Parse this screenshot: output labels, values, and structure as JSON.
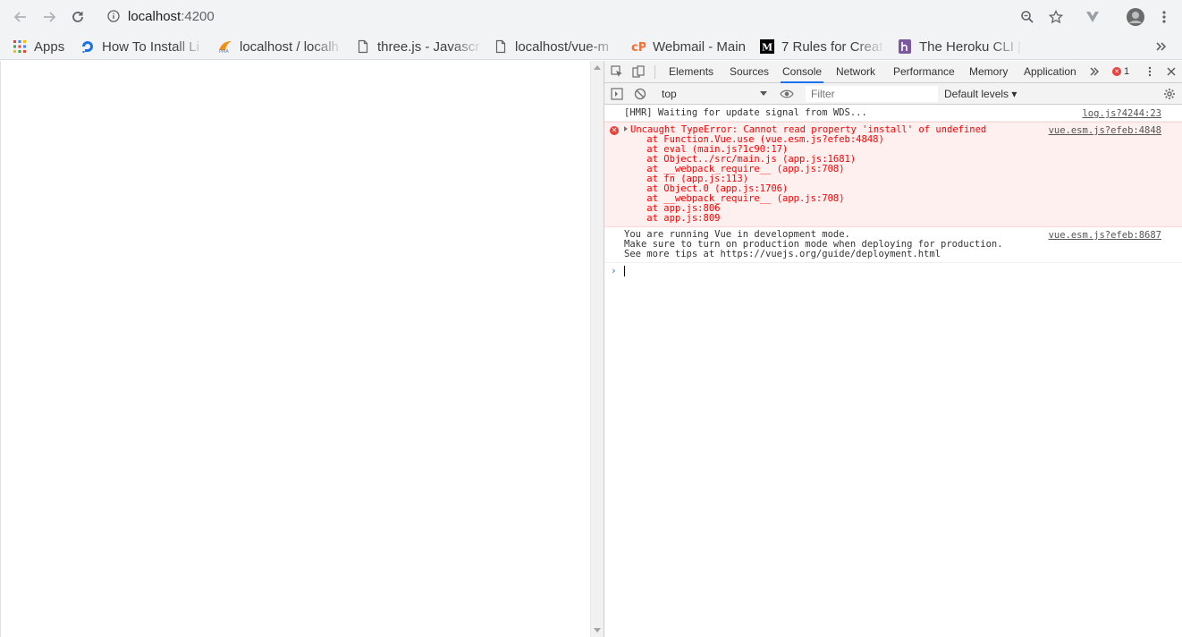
{
  "browser": {
    "url_host": "localhost",
    "url_port": ":4200",
    "colors": {
      "toolbar_bg": "#f1f3f4",
      "accent": "#1a73e8"
    }
  },
  "bookmarks": [
    {
      "label": "Apps",
      "icon": "apps-grid-icon"
    },
    {
      "label": "How To Install Li",
      "icon": "digitalocean-icon"
    },
    {
      "label": "localhost / localh",
      "icon": "phpmyadmin-icon"
    },
    {
      "label": "three.js - Javascr",
      "icon": "page-icon"
    },
    {
      "label": "localhost/vue-m",
      "icon": "page-icon"
    },
    {
      "label": "Webmail - Main",
      "icon": "cpanel-icon"
    },
    {
      "label": "7 Rules for Creat",
      "icon": "medium-icon"
    },
    {
      "label": "The Heroku CLI |",
      "icon": "heroku-icon"
    }
  ],
  "devtools": {
    "tabs": [
      "Elements",
      "Sources",
      "Console",
      "Network",
      "Performance",
      "Memory",
      "Application"
    ],
    "active_tab": "Console",
    "error_count": "1",
    "context": "top",
    "filter_placeholder": "Filter",
    "levels_label": "Default levels ▾",
    "messages": [
      {
        "type": "log",
        "lines": [
          "[HMR] Waiting for update signal from WDS..."
        ],
        "source": "log.js?4244:23"
      },
      {
        "type": "error",
        "source": "vue.esm.js?efeb:4848",
        "lines": [
          "Uncaught TypeError: Cannot read property 'install' of undefined",
          "    at Function.Vue.use (vue.esm.js?efeb:4848)",
          "    at eval (main.js?1c90:17)",
          "    at Object../src/main.js (app.js:1681)",
          "    at __webpack_require__ (app.js:708)",
          "    at fn (app.js:113)",
          "    at Object.0 (app.js:1706)",
          "    at __webpack_require__ (app.js:708)",
          "    at app.js:806",
          "    at app.js:809"
        ]
      },
      {
        "type": "log",
        "source": "vue.esm.js?efeb:8687",
        "lines": [
          "You are running Vue in development mode.",
          "Make sure to turn on production mode when deploying for production.",
          "See more tips at https://vuejs.org/guide/deployment.html"
        ]
      }
    ]
  }
}
